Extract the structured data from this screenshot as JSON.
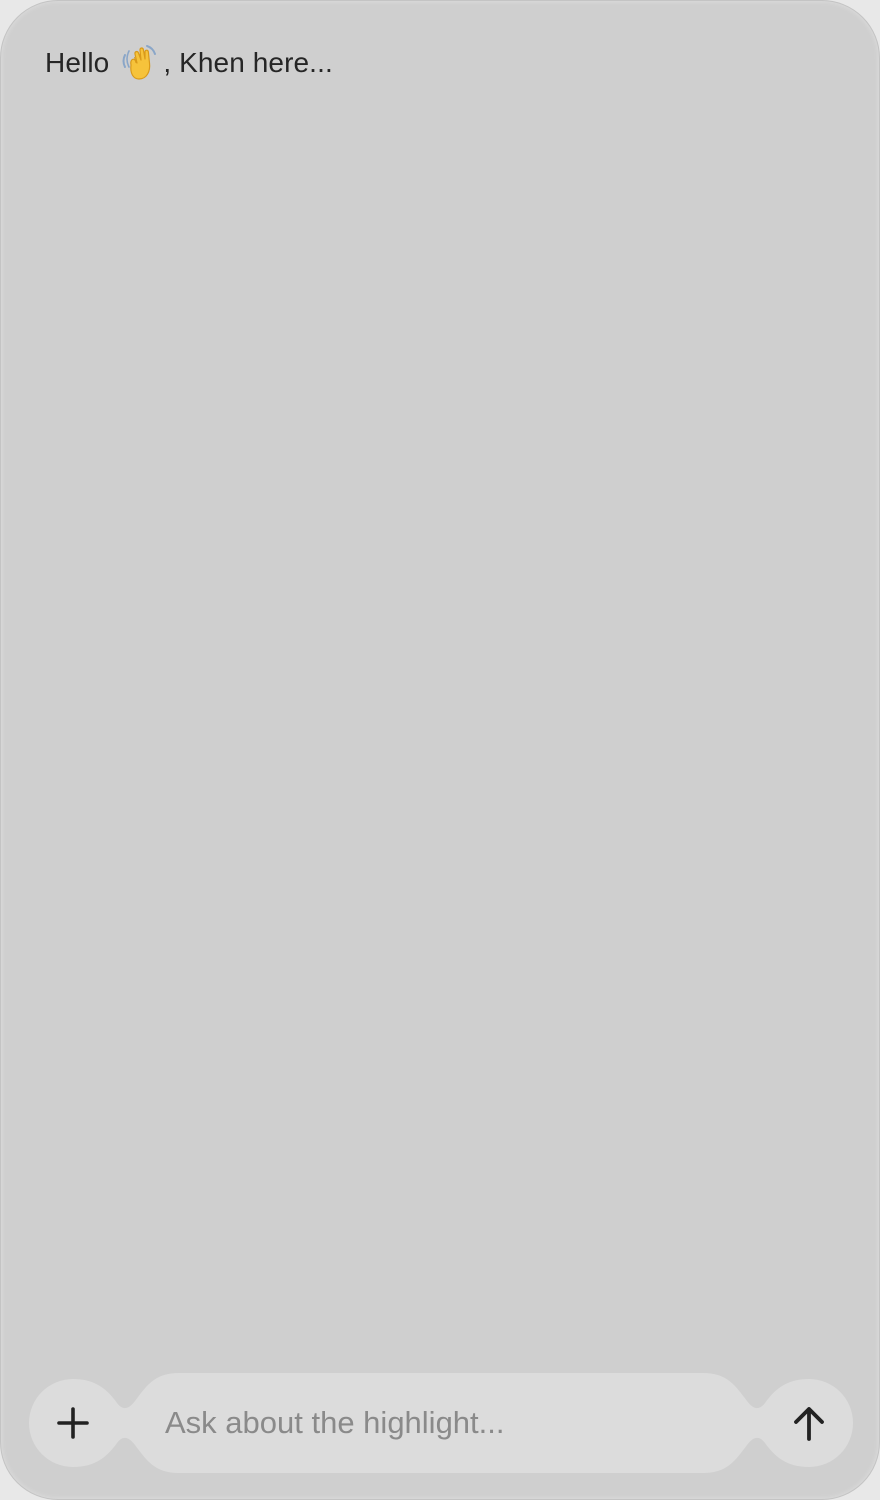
{
  "header": {
    "greeting_prefix": "Hello",
    "greeting_emoji": "waving-hand-icon",
    "greeting_suffix": ", Khen here..."
  },
  "composer": {
    "input_value": "",
    "input_placeholder": "Ask about the highlight...",
    "add_icon": "plus-icon",
    "send_icon": "arrow-up-icon"
  },
  "colors": {
    "window_background": "#cfcfcf",
    "composer_fill": "#dcdcdc",
    "text": "#262626",
    "placeholder": "#8a8a8a"
  }
}
